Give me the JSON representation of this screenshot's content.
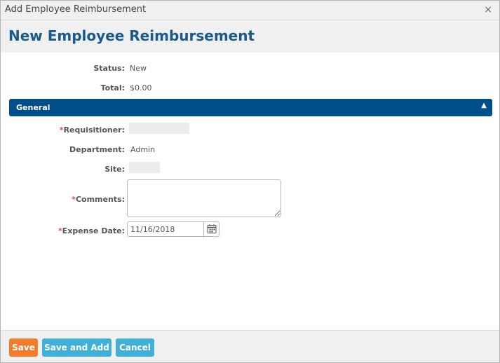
{
  "window": {
    "title": "Add Employee Reimbursement",
    "close_glyph": "×"
  },
  "header": {
    "heading": "New Employee Reimbursement"
  },
  "summary": {
    "status_label": "Status:",
    "status_value": "New",
    "total_label": "Total:",
    "total_value": "$0.00"
  },
  "section": {
    "title": "General",
    "toggle_glyph": "▲"
  },
  "form": {
    "required_marker": "*",
    "requisitioner_label": "Requisitioner:",
    "department_label": "Department:",
    "department_value": "Admin",
    "site_label": "Site:",
    "comments_label": "Comments:",
    "comments_value": "",
    "expense_date_label": "Expense Date:",
    "expense_date_value": "11/16/2018"
  },
  "footer": {
    "save_label": "Save",
    "save_and_add_label": "Save and Add",
    "cancel_label": "Cancel"
  },
  "colors": {
    "heading": "#1a5a8a",
    "section_bar": "#004f8b",
    "save_button": "#f47b2a",
    "secondary_button": "#3fb0d8",
    "required": "#d9534f"
  },
  "icons": {
    "close": "close-icon",
    "section_toggle": "chevron-up-icon",
    "date_picker": "calendar-icon"
  }
}
